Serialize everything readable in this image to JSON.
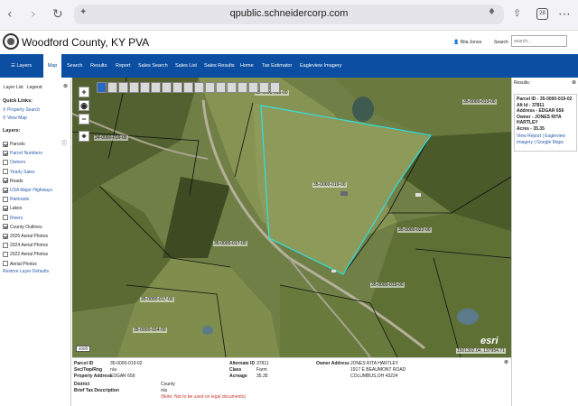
{
  "browser": {
    "url": "qpublic.schneidercorp.com",
    "tab_count": "28"
  },
  "header": {
    "title": "Woodford County, KY PVA",
    "user": "Rita Jones",
    "search_label": "Search",
    "search_placeholder": "search..."
  },
  "nav": {
    "items": [
      "Layers",
      "Map",
      "Search",
      "Results",
      "Report",
      "Sales Search",
      "Sales List",
      "Sales Results",
      "Home",
      "Tax Estimator",
      "Eagleview Imagery"
    ],
    "active": "Map"
  },
  "sidebar": {
    "tabs": [
      "Layer List",
      "Legend"
    ],
    "quick_links_title": "Quick Links:",
    "quick_links": [
      "Property Search",
      "View Map"
    ],
    "layers_title": "Layers:",
    "layers": [
      {
        "label": "Parcels",
        "checked": true
      },
      {
        "label": "Parcel Numbers",
        "checked": true
      },
      {
        "label": "Owners",
        "checked": false
      },
      {
        "label": "Yearly Sales",
        "checked": false
      },
      {
        "label": "Roads",
        "checked": true
      },
      {
        "label": "USA Major Highways",
        "checked": true
      },
      {
        "label": "Railroads",
        "checked": false
      },
      {
        "label": "Lakes",
        "checked": true
      },
      {
        "label": "Rivers",
        "checked": false
      },
      {
        "label": "County Outlines",
        "checked": true
      },
      {
        "label": "2026 Aerial Photos",
        "checked": true
      },
      {
        "label": "2024 Aerial Photos",
        "checked": false
      },
      {
        "label": "2022 Aerial Photos",
        "checked": false
      },
      {
        "label": "Aerial Photos",
        "checked": false
      }
    ],
    "restore_link": "Restore Layer Defaults"
  },
  "map": {
    "parcel_labels": [
      "35-0000-015-00",
      "24-0000-016-00",
      "35-0000-013-00",
      "35-0000-019-00",
      "35-0000-017-00",
      "35-0000-022-00",
      "35-0000-019-00",
      "35-0000-017-00",
      "35-0000-024-00"
    ],
    "scale_label": "400ft",
    "attribution": "1501302.04, 137954.71",
    "esri": "esri"
  },
  "results": {
    "title": "Results:",
    "parcel_id": "Parcel ID - 35-0000-019-02",
    "alt_id": "Alt Id - 37811",
    "address": "Address - EDGAR 656",
    "owner": "Owner - JONES RITA HARTLEY",
    "acres": "Acres - 35.35",
    "view_links": "View Report | Eagleview Imagery | Google Maps"
  },
  "bottom": {
    "parcel_id_label": "Parcel ID",
    "parcel_id": "35-0000-019-02",
    "sec_label": "Sec/Twp/Rng",
    "sec": "n/a",
    "prop_addr_label": "Property Address",
    "prop_addr": "EDGAR 656",
    "district_label": "District",
    "district": "County",
    "brief_label": "Brief Tax Description",
    "brief": "n/a",
    "note": "(Note: Not to be used on legal documents)",
    "alt_label": "Alternate ID",
    "alt": "37811",
    "class_label": "Class",
    "class": "Farm",
    "acreage_label": "Acreage",
    "acreage": "35.35",
    "owner_label": "Owner Address",
    "owner_name": "JONES RITA HARTLEY",
    "owner_street": "1917 E BEAUMONT ROAD",
    "owner_city": "COLUMBUS,OH 43224"
  }
}
